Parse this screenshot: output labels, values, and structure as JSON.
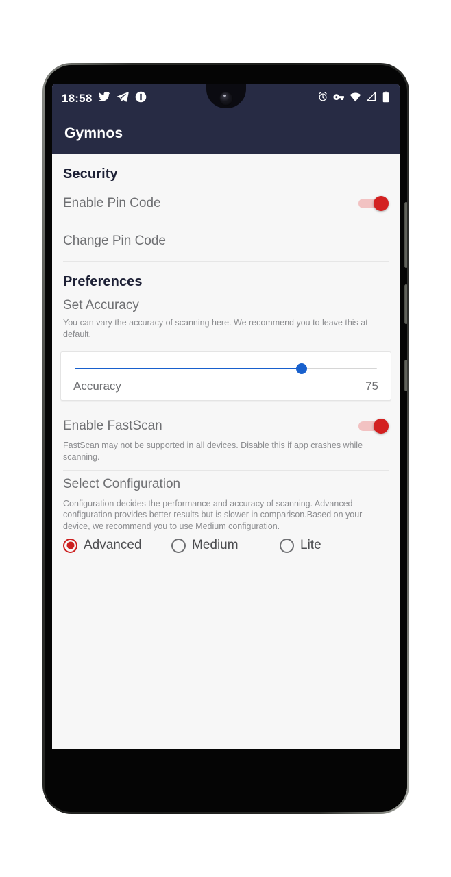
{
  "status_bar": {
    "time": "18:58",
    "left_icons": [
      "twitter-icon",
      "telegram-icon",
      "notification-badge-icon"
    ],
    "right_icons": [
      "alarm-icon",
      "vpn-key-icon",
      "wifi-icon",
      "signal-icon",
      "battery-icon"
    ],
    "background_color": "#272b44"
  },
  "app_bar": {
    "title": "Gymnos",
    "background_color": "#272b44",
    "text_color": "#ffffff"
  },
  "sections": {
    "security": {
      "header": "Security",
      "enable_pin": {
        "title": "Enable Pin Code",
        "toggle_state": "on",
        "toggle_color": "#d32020",
        "track_color": "#f2c2c2"
      },
      "change_pin": {
        "title": "Change Pin Code"
      }
    },
    "preferences": {
      "header": "Preferences",
      "set_accuracy": {
        "title": "Set Accuracy",
        "description": "You can vary the accuracy of scanning here. We recommend you to leave this at default.",
        "slider": {
          "label": "Accuracy",
          "value": "75",
          "percent": 75,
          "accent_color": "#1860cd"
        }
      },
      "enable_fastscan": {
        "title": "Enable FastScan",
        "description": "FastScan may not be supported in all devices. Disable this if app crashes while scanning.",
        "toggle_state": "on",
        "toggle_color": "#d32020",
        "track_color": "#f2c2c2"
      },
      "select_configuration": {
        "title": "Select Configuration",
        "description": "Configuration decides the performance and accuracy of scanning. Advanced configuration provides better results but is slower in comparison.Based on your device, we recommend you to use Medium configuration.",
        "selected": "Advanced",
        "accent_color": "#cc1f1f",
        "options": [
          {
            "label": "Advanced",
            "checked": true
          },
          {
            "label": "Medium",
            "checked": false
          },
          {
            "label": "Lite",
            "checked": false
          }
        ]
      }
    }
  },
  "nav_bar": {
    "back_icon": "chevron-left-icon",
    "home_icon": "home-pill-indicator",
    "background_color": "#000000"
  }
}
